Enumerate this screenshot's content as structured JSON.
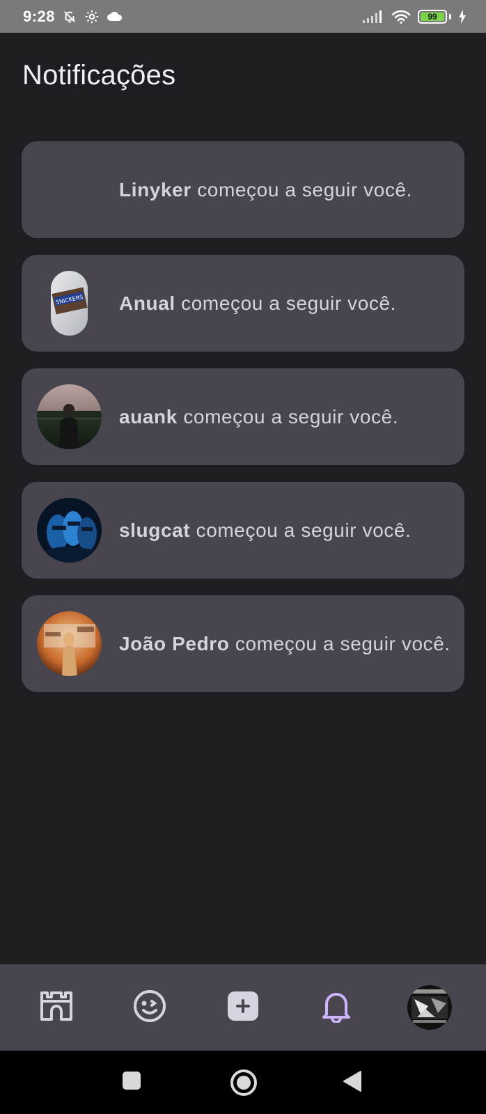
{
  "status_bar": {
    "time": "9:28",
    "battery": "99",
    "icons": [
      "mute-bell-icon",
      "gear-icon",
      "cloud-icon",
      "signal-icon",
      "wifi-icon",
      "battery-icon",
      "charging-icon"
    ]
  },
  "page": {
    "title": "Notificações"
  },
  "notifications": [
    {
      "user": "Linyker",
      "message": " começou a seguir você.",
      "avatar": "none"
    },
    {
      "user": "Anual",
      "message": " começou a seguir você.",
      "avatar": "snickers-photo"
    },
    {
      "user": "auank",
      "message": " começou a seguir você.",
      "avatar": "person-photo"
    },
    {
      "user": "slugcat",
      "message": " começou a seguir você.",
      "avatar": "blue-poster-photo"
    },
    {
      "user": "João Pedro",
      "message": " começou a seguir você.",
      "avatar": "orange-wall-photo"
    }
  ],
  "bottom_nav": {
    "items": [
      "home-icon",
      "feed-icon",
      "create-post-icon",
      "notifications-icon",
      "profile-avatar"
    ],
    "active": "notifications-icon",
    "active_color": "#cdb6ff"
  },
  "system_nav": {
    "items": [
      "recents-icon",
      "home-circle-icon",
      "back-icon"
    ]
  }
}
